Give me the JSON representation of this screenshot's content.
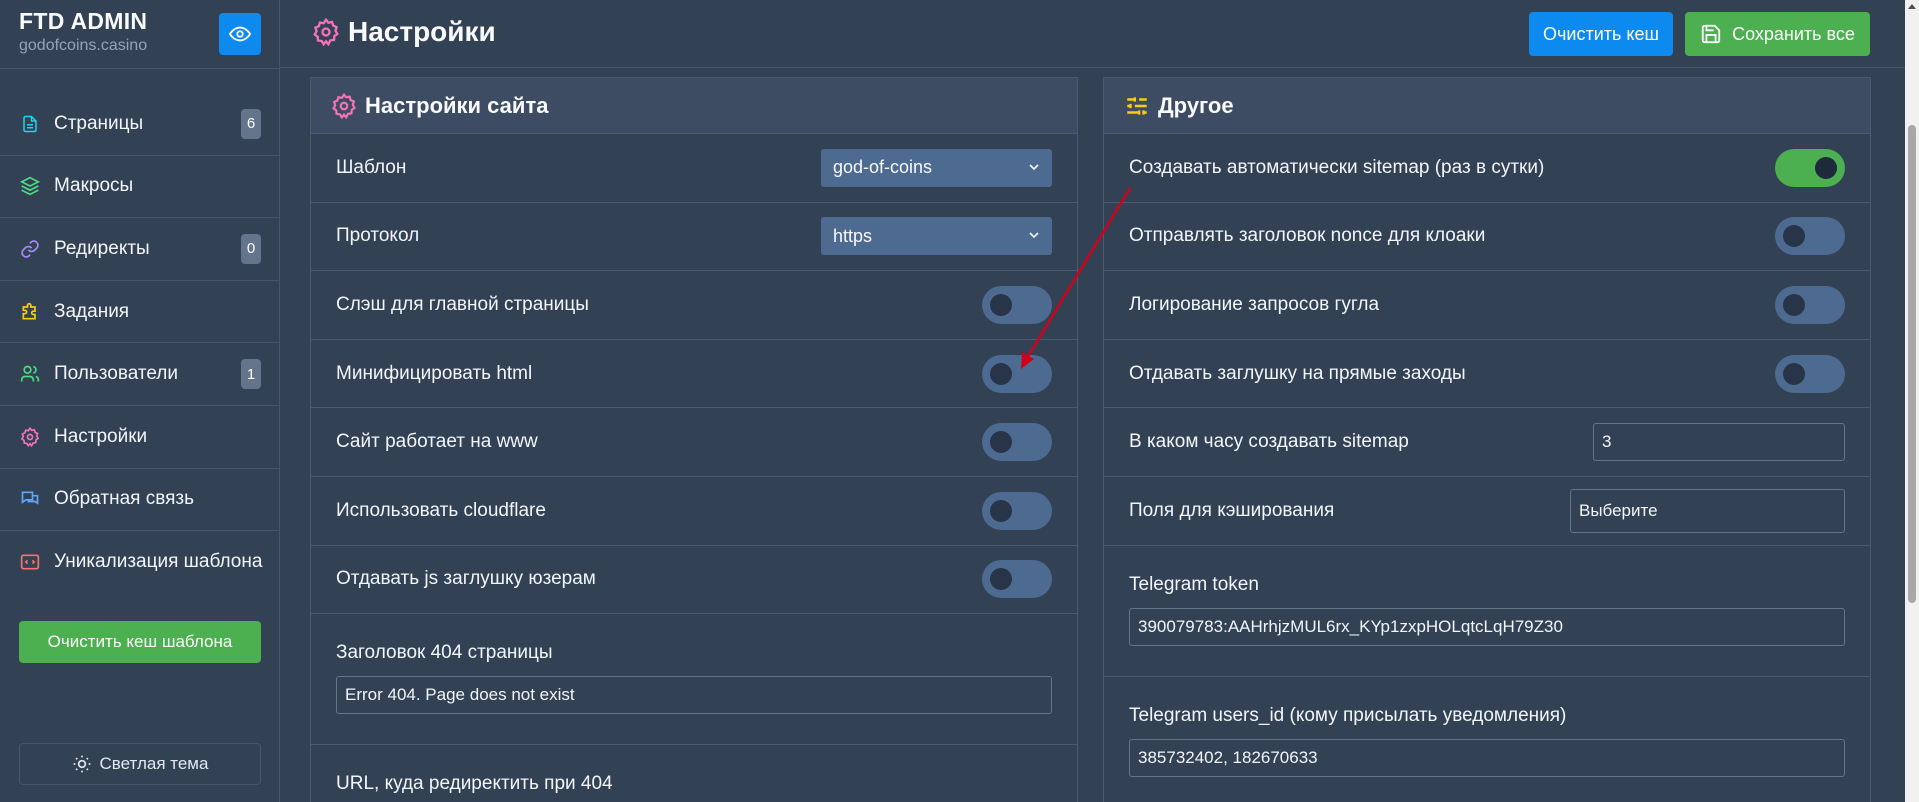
{
  "brand": {
    "title": "FTD ADMIN",
    "subtitle": "godofcoins.casino"
  },
  "sidebar": {
    "items": [
      {
        "label": "Страницы",
        "badge": "6",
        "icon": "file-icon",
        "color": "#22d3ee"
      },
      {
        "label": "Макросы",
        "badge": null,
        "icon": "layers-icon",
        "color": "#4ade80"
      },
      {
        "label": "Редиректы",
        "badge": "0",
        "icon": "link-icon",
        "color": "#a78bfa"
      },
      {
        "label": "Задания",
        "badge": null,
        "icon": "puzzle-icon",
        "color": "#facc15"
      },
      {
        "label": "Пользователи",
        "badge": "1",
        "icon": "users-icon",
        "color": "#4ade80"
      },
      {
        "label": "Настройки",
        "badge": null,
        "icon": "gear-icon",
        "color": "#f472b6"
      },
      {
        "label": "Обратная связь",
        "badge": null,
        "icon": "chat-icon",
        "color": "#60a5fa"
      },
      {
        "label": "Уникализация шаблона",
        "badge": null,
        "icon": "code-icon",
        "color": "#f87171"
      }
    ],
    "clear_template_cache": "Очистить кеш шаблона",
    "theme_toggle": "Светлая тема"
  },
  "header": {
    "title": "Настройки",
    "clear_cache": "Очистить кеш",
    "save_all": "Сохранить все"
  },
  "site_settings": {
    "title": "Настройки сайта",
    "template_label": "Шаблон",
    "template_value": "god-of-coins",
    "protocol_label": "Протокол",
    "protocol_value": "https",
    "toggles": [
      {
        "label": "Слэш для главной страницы",
        "on": false
      },
      {
        "label": "Минифицировать html",
        "on": false
      },
      {
        "label": "Сайт работает на www",
        "on": false
      },
      {
        "label": "Использовать cloudflare",
        "on": false
      },
      {
        "label": "Отдавать js заглушку юзерам",
        "on": false
      }
    ],
    "title_404_label": "Заголовок 404 страницы",
    "title_404_value": "Error 404. Page does not exist",
    "redirect_404_label": "URL, куда редиректить при 404"
  },
  "other": {
    "title": "Другое",
    "toggles": [
      {
        "label": "Создавать автоматически sitemap (раз в сутки)",
        "on": true
      },
      {
        "label": "Отправлять заголовок nonce для клоаки",
        "on": false
      },
      {
        "label": "Логирование запросов гугла",
        "on": false
      },
      {
        "label": "Отдавать заглушку на прямые заходы",
        "on": false
      }
    ],
    "sitemap_hour_label": "В каком часу создавать sitemap",
    "sitemap_hour_value": "3",
    "cache_fields_label": "Поля для кэширования",
    "cache_fields_value": "Выберите",
    "telegram_token_label": "Telegram token",
    "telegram_token_value": "390079783:AAHrhjzMUL6rx_KYp1zxpHOLqtcLqH79Z30",
    "telegram_users_label": "Telegram users_id (кому присылать уведомления)",
    "telegram_users_value": "385732402, 182670633"
  },
  "colors": {
    "accent_blue": "#0d8aef",
    "accent_green": "#4caf50",
    "gear_pink": "#f472b6",
    "sliders_yellow": "#facc15",
    "annotation_red": "#d0021b"
  }
}
